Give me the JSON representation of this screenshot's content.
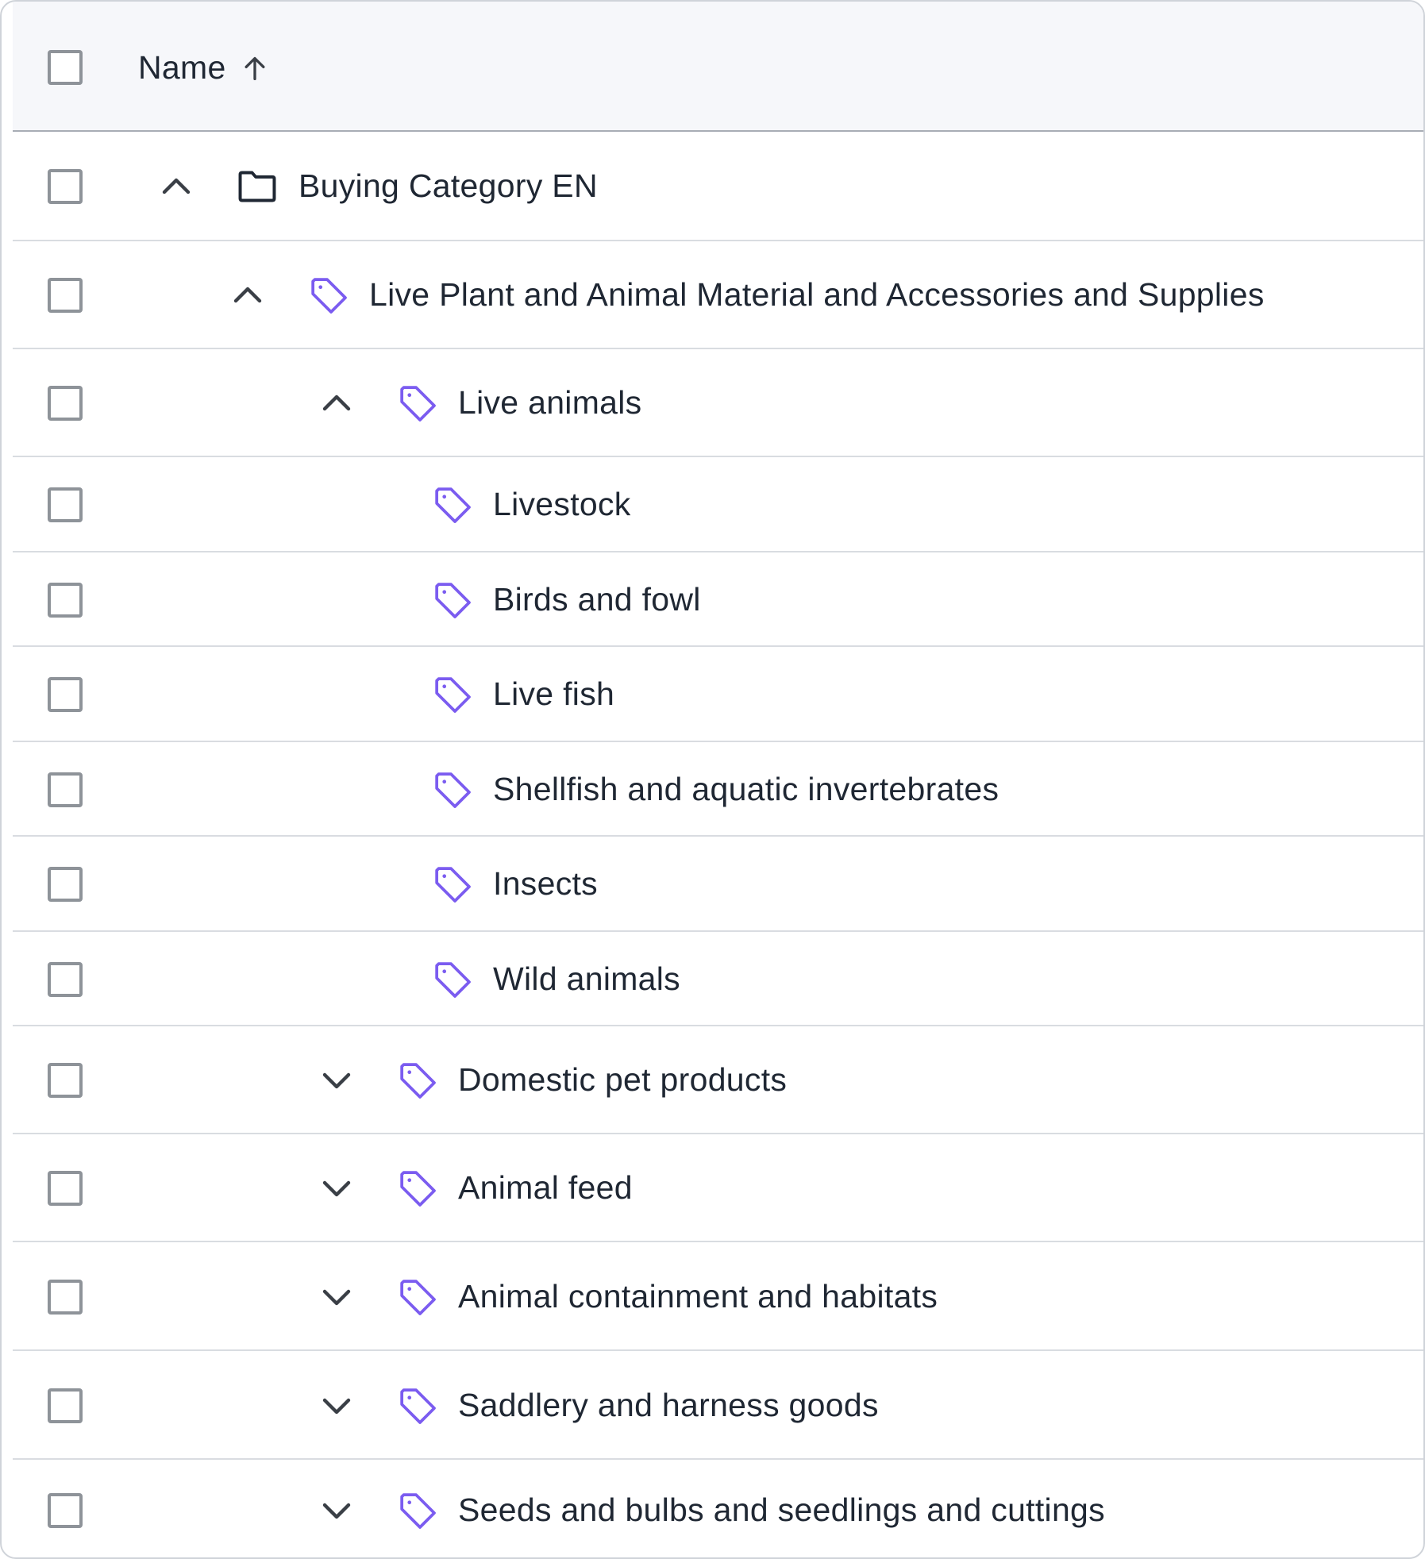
{
  "header": {
    "column_label": "Name",
    "sort_icon": "arrow-up-icon"
  },
  "colors": {
    "tag_icon": "#7b5cf0",
    "folder_icon": "#1f2733",
    "chevron": "#3a3f46",
    "checkbox_border": "#8e9399",
    "header_bg": "#f6f7fa"
  },
  "rows": [
    {
      "label": "Buying Category EN",
      "icon": "folder-icon",
      "chevron": "chevron-up-icon",
      "level": 0,
      "expanded": true
    },
    {
      "label": "Live Plant and Animal Material and Accessories and Supplies",
      "icon": "tag-icon",
      "chevron": "chevron-up-icon",
      "level": 1,
      "expanded": true
    },
    {
      "label": "Live animals",
      "icon": "tag-icon",
      "chevron": "chevron-up-icon",
      "level": 2,
      "expanded": true
    },
    {
      "label": "Livestock",
      "icon": "tag-icon",
      "chevron": "",
      "level": 3
    },
    {
      "label": "Birds and fowl",
      "icon": "tag-icon",
      "chevron": "",
      "level": 3
    },
    {
      "label": "Live fish",
      "icon": "tag-icon",
      "chevron": "",
      "level": 3
    },
    {
      "label": "Shellfish and aquatic invertebrates",
      "icon": "tag-icon",
      "chevron": "",
      "level": 3
    },
    {
      "label": "Insects",
      "icon": "tag-icon",
      "chevron": "",
      "level": 3
    },
    {
      "label": "Wild animals",
      "icon": "tag-icon",
      "chevron": "",
      "level": 3
    },
    {
      "label": "Domestic pet products",
      "icon": "tag-icon",
      "chevron": "chevron-down-icon",
      "level": 2,
      "expanded": false
    },
    {
      "label": "Animal feed",
      "icon": "tag-icon",
      "chevron": "chevron-down-icon",
      "level": 2,
      "expanded": false
    },
    {
      "label": "Animal containment and habitats",
      "icon": "tag-icon",
      "chevron": "chevron-down-icon",
      "level": 2,
      "expanded": false
    },
    {
      "label": "Saddlery and harness goods",
      "icon": "tag-icon",
      "chevron": "chevron-down-icon",
      "level": 2,
      "expanded": false
    },
    {
      "label": "Seeds and bulbs and seedlings and cuttings",
      "icon": "tag-icon",
      "chevron": "chevron-down-icon",
      "level": 2,
      "expanded": false
    }
  ]
}
